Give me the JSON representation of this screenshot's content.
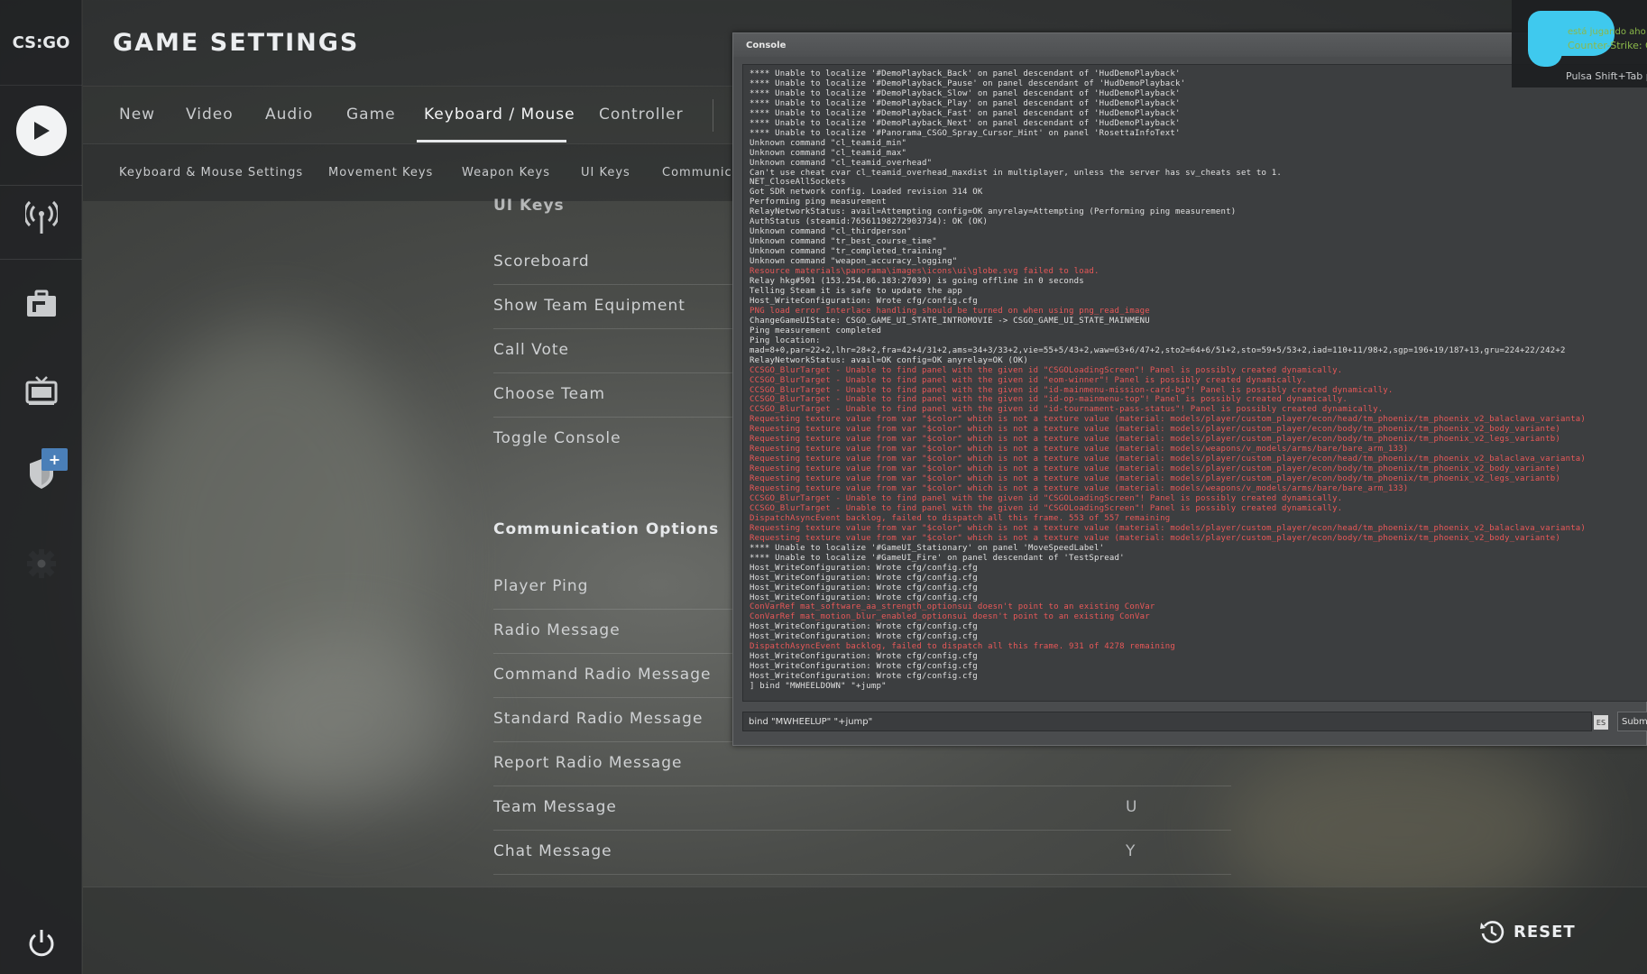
{
  "sidebar": {
    "logo_text": "CS:GO",
    "icons": [
      "play-icon",
      "broadcast-icon",
      "briefcase-icon",
      "tv-icon",
      "shield-icon",
      "gear-icon",
      "power-icon"
    ],
    "badge": "+"
  },
  "header": {
    "title": "GAME SETTINGS"
  },
  "tabs": [
    {
      "label": "New"
    },
    {
      "label": "Video"
    },
    {
      "label": "Audio"
    },
    {
      "label": "Game"
    },
    {
      "label": "Keyboard / Mouse",
      "active": true
    },
    {
      "label": "Controller"
    }
  ],
  "subtabs": [
    {
      "label": "Keyboard & Mouse Settings"
    },
    {
      "label": "Movement Keys"
    },
    {
      "label": "Weapon Keys"
    },
    {
      "label": "UI Keys"
    },
    {
      "label": "Communica"
    }
  ],
  "ui_keys": {
    "heading": "UI Keys",
    "rows": [
      {
        "label": "Scoreboard",
        "value": ""
      },
      {
        "label": "Show Team Equipment",
        "value": ""
      },
      {
        "label": "Call Vote",
        "value": ""
      },
      {
        "label": "Choose Team",
        "value": ""
      },
      {
        "label": "Toggle Console",
        "value": ""
      }
    ]
  },
  "communication": {
    "heading": "Communication Options",
    "rows": [
      {
        "label": "Player Ping",
        "value": ""
      },
      {
        "label": "Radio Message",
        "value": ""
      },
      {
        "label": "Command Radio Message",
        "value": ""
      },
      {
        "label": "Standard Radio Message",
        "value": ""
      },
      {
        "label": "Report Radio Message",
        "value": ""
      },
      {
        "label": "Team Message",
        "value": "U"
      },
      {
        "label": "Chat Message",
        "value": "Y"
      }
    ]
  },
  "footer": {
    "reset_label": "RESET"
  },
  "console": {
    "title": "Console",
    "input_value": "bind \"MWHEELUP\" \"+jump\"",
    "es_label": "ES",
    "submit_label": "Submit",
    "lines": [
      {
        "t": "**** Unable to localize '#DemoPlayback_Back' on panel descendant of 'HudDemoPlayback'",
        "e": false
      },
      {
        "t": "**** Unable to localize '#DemoPlayback_Pause' on panel descendant of 'HudDemoPlayback'",
        "e": false
      },
      {
        "t": "**** Unable to localize '#DemoPlayback_Slow' on panel descendant of 'HudDemoPlayback'",
        "e": false
      },
      {
        "t": "**** Unable to localize '#DemoPlayback_Play' on panel descendant of 'HudDemoPlayback'",
        "e": false
      },
      {
        "t": "**** Unable to localize '#DemoPlayback_Fast' on panel descendant of 'HudDemoPlayback'",
        "e": false
      },
      {
        "t": "**** Unable to localize '#DemoPlayback_Next' on panel descendant of 'HudDemoPlayback'",
        "e": false
      },
      {
        "t": "**** Unable to localize '#Panorama_CSGO_Spray_Cursor_Hint' on panel 'RosettaInfoText'",
        "e": false
      },
      {
        "t": "Unknown command \"cl_teamid_min\"",
        "e": false
      },
      {
        "t": "Unknown command \"cl_teamid_max\"",
        "e": false
      },
      {
        "t": "Unknown command \"cl_teamid_overhead\"",
        "e": false
      },
      {
        "t": "Can't use cheat cvar cl_teamid_overhead_maxdist in multiplayer, unless the server has sv_cheats set to 1.",
        "e": false
      },
      {
        "t": "NET_CloseAllSockets",
        "e": false
      },
      {
        "t": "Got SDR network config.  Loaded revision 314 OK",
        "e": false
      },
      {
        "t": "Performing ping measurement",
        "e": false
      },
      {
        "t": "RelayNetworkStatus:  avail=Attempting  config=OK  anyrelay=Attempting   (Performing ping measurement)",
        "e": false
      },
      {
        "t": "AuthStatus (steamid:76561198272903734):  OK  (OK)",
        "e": false
      },
      {
        "t": "Unknown command \"cl_thirdperson\"",
        "e": false
      },
      {
        "t": "Unknown command \"tr_best_course_time\"",
        "e": false
      },
      {
        "t": "Unknown command \"tr_completed_training\"",
        "e": false
      },
      {
        "t": "Unknown command \"weapon_accuracy_logging\"",
        "e": false
      },
      {
        "t": "Resource materials\\panorama\\images\\icons\\ui\\globe.svg failed to load.",
        "e": true
      },
      {
        "t": "Relay hkg#501 (153.254.86.183:27039) is going offline in 0 seconds",
        "e": false
      },
      {
        "t": "Telling Steam it is safe to update the app",
        "e": false
      },
      {
        "t": "Host_WriteConfiguration: Wrote cfg/config.cfg",
        "e": false
      },
      {
        "t": "PNG load error Interlace handling should be turned on when using png_read_image",
        "e": true
      },
      {
        "t": "ChangeGameUIState: CSGO_GAME_UI_STATE_INTROMOVIE -> CSGO_GAME_UI_STATE_MAINMENU",
        "e": false
      },
      {
        "t": "Ping measurement completed",
        "e": false
      },
      {
        "t": "Ping location:",
        "e": false
      },
      {
        "t": "mad=8+0,par=22+2,lhr=28+2,fra=42+4/31+2,ams=34+3/33+2,vie=55+5/43+2,waw=63+6/47+2,sto2=64+6/51+2,sto=59+5/53+2,iad=110+11/98+2,sgp=196+19/187+13,gru=224+22/242+2",
        "e": false
      },
      {
        "t": "RelayNetworkStatus:  avail=OK  config=OK  anyrelay=OK   (OK)",
        "e": false
      },
      {
        "t": "CCSGO_BlurTarget - Unable to find panel with the given id \"CSGOLoadingScreen\"! Panel is possibly created dynamically.",
        "e": true
      },
      {
        "t": "CCSGO_BlurTarget - Unable to find panel with the given id \"eom-winner\"! Panel is possibly created dynamically.",
        "e": true
      },
      {
        "t": "CCSGO_BlurTarget - Unable to find panel with the given id \"id-mainmenu-mission-card-bg\"! Panel is possibly created dynamically.",
        "e": true
      },
      {
        "t": "CCSGO_BlurTarget - Unable to find panel with the given id \"id-op-mainmenu-top\"! Panel is possibly created dynamically.",
        "e": true
      },
      {
        "t": "CCSGO_BlurTarget - Unable to find panel with the given id \"id-tournament-pass-status\"! Panel is possibly created dynamically.",
        "e": true
      },
      {
        "t": "Requesting texture value from var \"$color\" which is not a texture value (material: models/player/custom_player/econ/head/tm_phoenix/tm_phoenix_v2_balaclava_variantа)",
        "e": true
      },
      {
        "t": "Requesting texture value from var \"$color\" which is not a texture value (material: models/player/custom_player/econ/body/tm_phoenix/tm_phoenix_v2_body_variante)",
        "e": true
      },
      {
        "t": "Requesting texture value from var \"$color\" which is not a texture value (material: models/player/custom_player/econ/body/tm_phoenix/tm_phoenix_v2_legs_variantb)",
        "e": true
      },
      {
        "t": "Requesting texture value from var \"$color\" which is not a texture value (material: models/weapons/v_models/arms/bare/bare_arm_133)",
        "e": true
      },
      {
        "t": "Requesting texture value from var \"$color\" which is not a texture value (material: models/player/custom_player/econ/head/tm_phoenix/tm_phoenix_v2_balaclava_variantа)",
        "e": true
      },
      {
        "t": "Requesting texture value from var \"$color\" which is not a texture value (material: models/player/custom_player/econ/body/tm_phoenix/tm_phoenix_v2_body_variante)",
        "e": true
      },
      {
        "t": "Requesting texture value from var \"$color\" which is not a texture value (material: models/player/custom_player/econ/body/tm_phoenix/tm_phoenix_v2_legs_variantb)",
        "e": true
      },
      {
        "t": "Requesting texture value from var \"$color\" which is not a texture value (material: models/weapons/v_models/arms/bare/bare_arm_133)",
        "e": true
      },
      {
        "t": "CCSGO_BlurTarget - Unable to find panel with the given id \"CSGOLoadingScreen\"! Panel is possibly created dynamically.",
        "e": true
      },
      {
        "t": "CCSGO_BlurTarget - Unable to find panel with the given id \"CSGOLoadingScreen\"! Panel is possibly created dynamically.",
        "e": true
      },
      {
        "t": "DispatchAsyncEvent backlog, failed to dispatch all this frame. 553 of 557 remaining",
        "e": true
      },
      {
        "t": "Requesting texture value from var \"$color\" which is not a texture value (material: models/player/custom_player/econ/head/tm_phoenix/tm_phoenix_v2_balaclava_variantа)",
        "e": true
      },
      {
        "t": "Requesting texture value from var \"$color\" which is not a texture value (material: models/player/custom_player/econ/body/tm_phoenix/tm_phoenix_v2_body_variante)",
        "e": true
      },
      {
        "t": "**** Unable to localize '#GameUI_Stationary' on panel 'MoveSpeedLabel'",
        "e": false
      },
      {
        "t": "**** Unable to localize '#GameUI_Fire' on panel descendant of 'TestSpread'",
        "e": false
      },
      {
        "t": "Host_WriteConfiguration: Wrote cfg/config.cfg",
        "e": false
      },
      {
        "t": "Host_WriteConfiguration: Wrote cfg/config.cfg",
        "e": false
      },
      {
        "t": "Host_WriteConfiguration: Wrote cfg/config.cfg",
        "e": false
      },
      {
        "t": "Host_WriteConfiguration: Wrote cfg/config.cfg",
        "e": false
      },
      {
        "t": "ConVarRef mat_software_aa_strength_optionsui doesn't point to an existing ConVar",
        "e": true
      },
      {
        "t": "ConVarRef mat_motion_blur_enabled_optionsui doesn't point to an existing ConVar",
        "e": true
      },
      {
        "t": "Host_WriteConfiguration: Wrote cfg/config.cfg",
        "e": false
      },
      {
        "t": "Host_WriteConfiguration: Wrote cfg/config.cfg",
        "e": false
      },
      {
        "t": "DispatchAsyncEvent backlog, failed to dispatch all this frame. 931 of 4278 remaining",
        "e": true
      },
      {
        "t": "Host_WriteConfiguration: Wrote cfg/config.cfg",
        "e": false
      },
      {
        "t": "Host_WriteConfiguration: Wrote cfg/config.cfg",
        "e": false
      },
      {
        "t": "Host_WriteConfiguration: Wrote cfg/config.cfg",
        "e": false
      },
      {
        "t": "] bind \"MWHEELDOWN\" \"+jump\"",
        "e": false
      }
    ]
  },
  "notification": {
    "line1": "está jugando aho",
    "line2": "Counter-Strike: G",
    "hint": "Pulsa Shift+Tab pa"
  },
  "colors": {
    "accent": "#e6e8ea",
    "error_text": "#e85858",
    "notification_green": "#8bb94a",
    "badge_blue": "#4a7fb8"
  }
}
